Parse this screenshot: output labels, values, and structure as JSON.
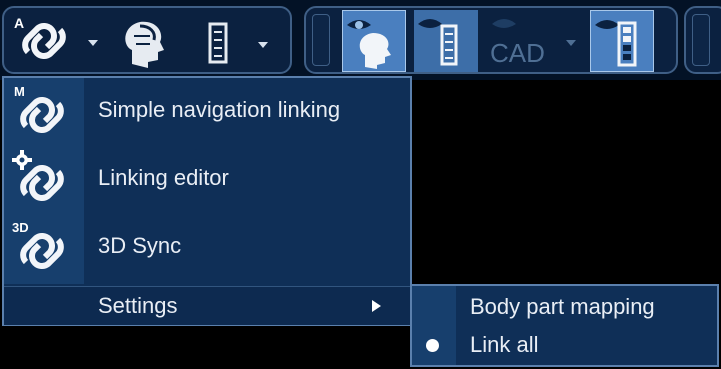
{
  "toolbar": {
    "buttons": [
      {
        "name": "link-mode-button",
        "icon": "link-icon",
        "badge": "A",
        "selected": false,
        "has_dropdown": true
      },
      {
        "name": "head-anatomy-button",
        "icon": "head-profile-icon",
        "selected": false,
        "has_dropdown": false
      },
      {
        "name": "slice-ruler-button",
        "icon": "ruler-icon",
        "selected": false,
        "has_dropdown": true
      },
      {
        "name": "orientation-view-button",
        "icon": "head-eye-icon",
        "selected": true,
        "has_dropdown": false
      },
      {
        "name": "ruler-eye-button",
        "icon": "ruler-eye-icon",
        "selected": false,
        "has_dropdown": false
      },
      {
        "name": "cad-button",
        "icon": "cad-icon",
        "label": "CAD",
        "selected": false,
        "has_dropdown": true
      },
      {
        "name": "slice-scale-button",
        "icon": "slice-scale-icon",
        "selected": true,
        "has_dropdown": false
      }
    ]
  },
  "menu": {
    "items": [
      {
        "label": "Simple navigation linking",
        "badge": "M",
        "icon": "link-icon"
      },
      {
        "label": "Linking editor",
        "badge": "",
        "icon": "link-gear-icon"
      },
      {
        "label": "3D Sync",
        "badge": "3D",
        "icon": "link-3d-icon"
      }
    ],
    "settings_label": "Settings"
  },
  "submenu": {
    "items": [
      {
        "label": "Body part mapping",
        "checked": false
      },
      {
        "label": "Link all",
        "checked": true
      }
    ]
  },
  "colors": {
    "toolbar_bg": "#031226",
    "menu_bg": "#0f2f57",
    "selected_bg": "#4a7fbf",
    "text": "#e9eef5"
  }
}
